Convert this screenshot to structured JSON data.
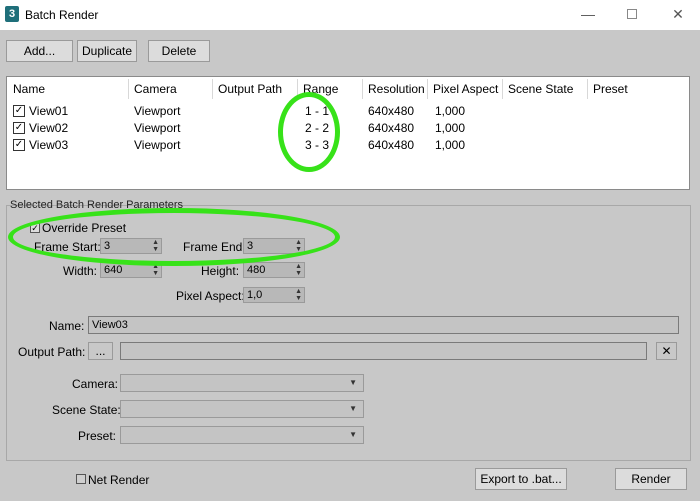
{
  "window": {
    "title": "Batch Render",
    "app_icon_text": "3",
    "minimize": "—",
    "close": "✕"
  },
  "toolbar": {
    "add": "Add...",
    "duplicate": "Duplicate",
    "delete": "Delete"
  },
  "list": {
    "columns": [
      "Name",
      "Camera",
      "Output Path",
      "Range",
      "Resolution",
      "Pixel Aspect",
      "Scene State",
      "Preset"
    ],
    "rows": [
      {
        "checked": true,
        "name": "View01",
        "camera": "Viewport",
        "output_path": "",
        "range": "1 - 1",
        "resolution": "640x480",
        "pixel_aspect": "1,000",
        "scene_state": "",
        "preset": ""
      },
      {
        "checked": true,
        "name": "View02",
        "camera": "Viewport",
        "output_path": "",
        "range": "2 - 2",
        "resolution": "640x480",
        "pixel_aspect": "1,000",
        "scene_state": "",
        "preset": ""
      },
      {
        "checked": true,
        "name": "View03",
        "camera": "Viewport",
        "output_path": "",
        "range": "3 - 3",
        "resolution": "640x480",
        "pixel_aspect": "1,000",
        "scene_state": "",
        "preset": ""
      }
    ]
  },
  "params": {
    "group_title": "Selected Batch Render Parameters",
    "override_preset": {
      "label": "Override Preset",
      "checked": true
    },
    "frame_start": {
      "label": "Frame Start:",
      "value": "3"
    },
    "frame_end": {
      "label": "Frame End:",
      "value": "3"
    },
    "width": {
      "label": "Width:",
      "value": "640"
    },
    "height": {
      "label": "Height:",
      "value": "480"
    },
    "pixel_aspect": {
      "label": "Pixel Aspect:",
      "value": "1,0"
    },
    "name": {
      "label": "Name:",
      "value": "View03"
    },
    "output_path": {
      "label": "Output Path:",
      "browse": "...",
      "value": ""
    },
    "camera": {
      "label": "Camera:",
      "value": ""
    },
    "scene_state": {
      "label": "Scene State:",
      "value": ""
    },
    "preset": {
      "label": "Preset:",
      "value": ""
    }
  },
  "footer": {
    "net_render": {
      "label": "Net Render",
      "checked": false
    },
    "export": "Export to .bat...",
    "render": "Render"
  },
  "colors": {
    "highlight": "#37e219",
    "background": "#c8c8c8"
  }
}
